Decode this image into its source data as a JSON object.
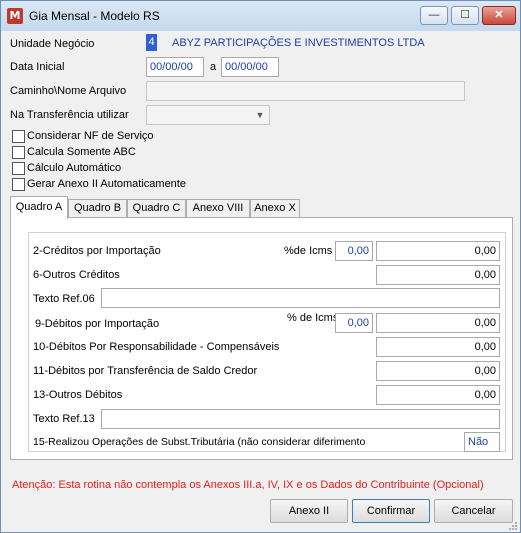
{
  "window": {
    "title": "Gia Mensal - Modelo RS",
    "app_icon": "M"
  },
  "titlebar_buttons": {
    "minimize": "—",
    "maximize": "☐",
    "close": "✕"
  },
  "form": {
    "unidade_label": "Unidade Negócio",
    "unidade_code": "4",
    "unidade_name": "ABYZ PARTICIPAÇÕES E INVESTIMENTOS LTDA",
    "data_inicial_label": "Data Inicial",
    "data_inicial_value": "00/00/00",
    "date_separator": "a",
    "data_final_value": "00/00/00",
    "caminho_label": "Caminho\\Nome Arquivo",
    "caminho_value": "",
    "transferencia_label": "Na Transferência utilizar",
    "transferencia_value": ""
  },
  "checkboxes": [
    {
      "label": "Considerar NF de Serviço",
      "checked": false
    },
    {
      "label": "Calcula Somente ABC",
      "checked": false
    },
    {
      "label": "Cálculo Automático",
      "checked": false
    },
    {
      "label": "Gerar Anexo II Automaticamente",
      "checked": false
    }
  ],
  "tabs": [
    "Quadro A",
    "Quadro B",
    "Quadro C",
    "Anexo VIII",
    "Anexo X"
  ],
  "active_tab": "Quadro A",
  "quadro_a": {
    "creditos_importacao_label": "2-Créditos por Importação",
    "pct_icms_label_1": "%de Icms",
    "pct_icms_value_1": "0,00",
    "creditos_importacao_value": "0,00",
    "outros_creditos_label": "6-Outros Créditos",
    "outros_creditos_value": "0,00",
    "texto_ref06_label": "Texto Ref.06",
    "texto_ref06_value": "",
    "debitos_importacao_label": "9-Débitos por Importação",
    "pct_icms_label_2": "% de Icms",
    "pct_icms_value_2": "0,00",
    "debitos_importacao_value": "0,00",
    "debitos_responsabilidade_label": "10-Débitos Por Responsabilidade - Compensáveis",
    "debitos_responsabilidade_value": "0,00",
    "debitos_transferencia_label": "11-Débitos por Transferência de Saldo Credor",
    "debitos_transferencia_value": "0,00",
    "outros_debitos_label": "13-Outros Débitos",
    "outros_debitos_value": "0,00",
    "texto_ref13_label": "Texto Ref.13",
    "texto_ref13_value": "",
    "subst_tributaria_label": "15-Realizou Operações de Subst.Tributária (não considerar diferimento",
    "subst_tributaria_value": "Não"
  },
  "warning": "Atenção: Esta rotina não contempla os Anexos III.a, IV, IX e os Dados do Contribuinte (Opcional)",
  "buttons": {
    "anexo": "Anexo II",
    "confirmar": "Confirmar",
    "cancelar": "Cancelar"
  },
  "colors": {
    "accent_blue": "#1a3faa",
    "warning_red": "#e02020"
  }
}
